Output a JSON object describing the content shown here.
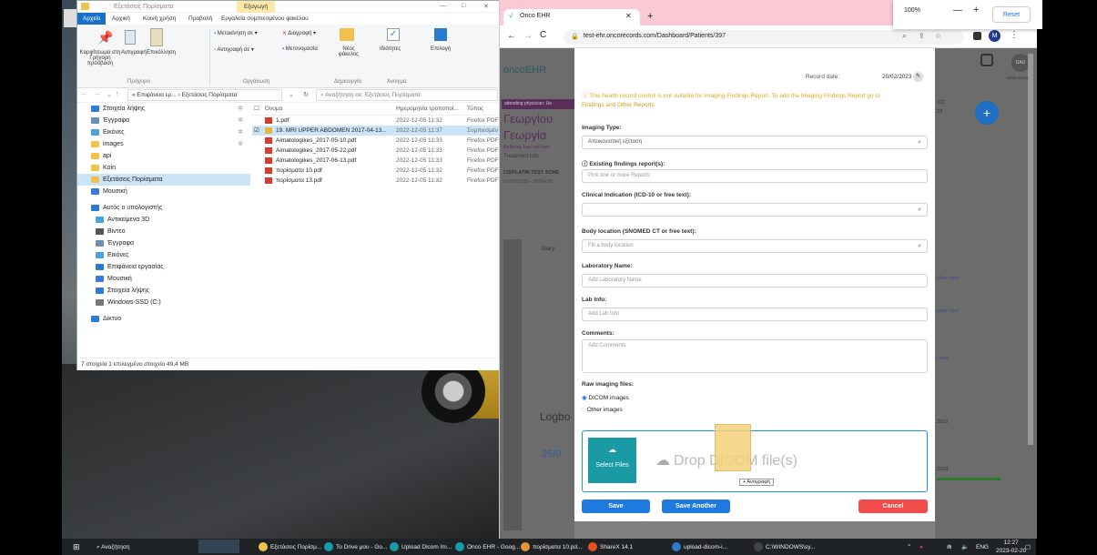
{
  "explorer": {
    "title": "Εξετάσεις Πορίσματα",
    "context_tab": "Εξαγωγή",
    "window_controls": [
      "—",
      "□",
      "✕"
    ],
    "menu": [
      "Αρχείο",
      "Αρχική",
      "Κοινή χρήση",
      "Προβολή",
      "Εργαλεία συμπιεσμένου φακέλου"
    ],
    "ribbon": {
      "pin": "Καρφίτσωμα στη Γρήγορη πρόσβαση",
      "copy": "Αντιγραφή",
      "paste": "Επικόλληση",
      "clipboard_group": "Πρόχειρο",
      "move_to": "Μετακίνηση σε",
      "delete": "Διαγραφή",
      "copy_to": "Αντιγραφή σε",
      "rename": "Μετονομασία",
      "organize_group": "Οργάνωση",
      "new_folder": "Νέος φάκελος",
      "create_group": "Δημιουργία",
      "properties": "Ιδιότητες",
      "open_group": "Άνοιγμα",
      "select": "Επιλογή"
    },
    "address": "« Επιφάνεια ερ... › Εξετάσεις Πορίσματα",
    "search_placeholder": "Αναζήτηση σε: Εξετάσεις Πορίσματα",
    "nav_items": [
      {
        "label": "Στοιχεία λήψης",
        "color": "#2e7bd6",
        "pin": "✲"
      },
      {
        "label": "Έγγραφα",
        "color": "#6a8fb3",
        "pin": "✲"
      },
      {
        "label": "Εικόνες",
        "color": "#4ea0d8",
        "pin": "✲"
      },
      {
        "label": "images",
        "color": "#f0c24b",
        "pin": "✲"
      },
      {
        "label": "api",
        "color": "#f0c24b",
        "pin": ""
      },
      {
        "label": "Koin",
        "color": "#f0c24b",
        "pin": ""
      },
      {
        "label": "Εξετάσεις Πορίσματα",
        "color": "#f0c24b",
        "pin": ""
      },
      {
        "label": "Μουσική",
        "color": "#3b7bd8",
        "pin": ""
      },
      {
        "label": "Αυτός ο υπολογιστής",
        "color": "#2a7ad0",
        "pin": ""
      },
      {
        "label": "Αντικείμενα 3D",
        "color": "#43a5e0",
        "pin": ""
      },
      {
        "label": "Βίντεο",
        "color": "#555",
        "pin": ""
      },
      {
        "label": "Έγγραφα",
        "color": "#6a8fb3",
        "pin": ""
      },
      {
        "label": "Εικόνες",
        "color": "#4ea0d8",
        "pin": ""
      },
      {
        "label": "Επιφάνεια εργασίας",
        "color": "#2a7ad0",
        "pin": ""
      },
      {
        "label": "Μουσική",
        "color": "#3b7bd8",
        "pin": ""
      },
      {
        "label": "Στοιχεία λήψης",
        "color": "#2e7bd6",
        "pin": ""
      },
      {
        "label": "Windows-SSD (C:)",
        "color": "#777",
        "pin": ""
      },
      {
        "label": "Δίκτυο",
        "color": "#2a7ad0",
        "pin": ""
      }
    ],
    "columns": [
      "Όνομα",
      "Ημερομηνία τροποποί...",
      "Τύπος"
    ],
    "files": [
      {
        "name": "1.pdf",
        "date": "2022-12-05 11:32",
        "type": "Firefox PDF",
        "icon": "#d83b2f",
        "selected": false
      },
      {
        "name": "19. MRI UPPER ABDOMEN 2017-04-13...",
        "date": "2022-12-05 11:37",
        "type": "Συμπιεσμέν",
        "icon": "#e8b63a",
        "selected": true
      },
      {
        "name": "Aimatologikes_2017-05-10.pdf",
        "date": "2022-12-05 11:33",
        "type": "Firefox PDF",
        "icon": "#d83b2f",
        "selected": false
      },
      {
        "name": "Aimatologikes_2017-05-22.pdf",
        "date": "2022-12-05 11:33",
        "type": "Firefox PDF",
        "icon": "#d83b2f",
        "selected": false
      },
      {
        "name": "Aimatologikes_2017-06-13.pdf",
        "date": "2022-12-05 11:33",
        "type": "Firefox PDF",
        "icon": "#d83b2f",
        "selected": false
      },
      {
        "name": "πορίσματα 10.pdf",
        "date": "2022-12-05 11:32",
        "type": "Firefox PDF",
        "icon": "#d83b2f",
        "selected": false
      },
      {
        "name": "πορίσματα 13.pdf",
        "date": "2022-12-05 11:32",
        "type": "Firefox PDF",
        "icon": "#d83b2f",
        "selected": false
      }
    ],
    "status": "7 στοιχεία    1 επιλεγμένο στοιχείο 49,4 MB"
  },
  "browser": {
    "tab_title": "Onco EHR",
    "url": "test-ehr.oncorecords.com/Dashboard/Patients/397",
    "zoom": "100%",
    "zoom_minus": "—",
    "zoom_plus": "+",
    "reset": "Reset",
    "avatar": "M"
  },
  "ehr": {
    "logo": "oncoEHR",
    "physician_badge": "attending physician: Ue",
    "patient_first": "Γεωργίου",
    "patient_last": "Γεωργία",
    "birthday_note": "Birthday has not bee",
    "treatment_info": "Treatment Info",
    "treatment_name": "CISPLATIN TEST SCHE",
    "treatment_dates": "02/02/2023 - 26/04/20",
    "diary": "Diary",
    "logbook": "Logbo",
    "log_date": "26/0",
    "user": "DAU",
    "user_name": "Admin Elina",
    "right_year": "022",
    "right_year2": "23",
    "right_links": [
      "efine now",
      "efine now",
      "l now"
    ],
    "right_date": "2023",
    "right_date2": "2023"
  },
  "modal": {
    "record_date_label": "Record date:",
    "record_date": "20/02/2023",
    "warning": "This health record control is not suitable for Imaging Findings Report. To add the Imaging Findings Report go to",
    "warning_link": "Findings and Other Reports",
    "imaging_type_label": "Imaging Type:",
    "imaging_type_value": "Απεικονιστική εξέταση",
    "existing_label": "Existing findings report(s):",
    "existing_placeholder": "Pick one or more Reports",
    "clinical_label": "Clinical Indication (ICD-10 or free text):",
    "body_label": "Body location (SNOMED CT or free text):",
    "body_placeholder": "Fill a body location",
    "lab_name_label": "Laboratory Name:",
    "lab_name_placeholder": "Add Laboratory Name",
    "lab_info_label": "Lab Info:",
    "lab_info_placeholder": "Add Lab Info",
    "comments_label": "Comments:",
    "comments_placeholder": "Add Comments",
    "raw_label": "Raw imaging files:",
    "radio_dicom": "DICOM images",
    "radio_other": "Other images",
    "select_files": "Select Files",
    "drop_text": "Drop DICOM file(s)",
    "drag_tooltip": "+ Αντιγραφή",
    "save": "Save",
    "save_another": "Save Another",
    "cancel": "Cancel"
  },
  "taskbar": {
    "search": "Αναζήτηση",
    "items": [
      "Εξετάσεις Πορίσμ...",
      "To Drive μου - Go...",
      "Upload Dicom Im...",
      "Onco EHR - Goog...",
      "πορίσματα 10.pd...",
      "ShareX 14.1",
      "upload-dicom-i...",
      "C:\\WINDOWS\\sy..."
    ],
    "lang": "ENG",
    "time": "12:27",
    "date": "2023-02-20"
  },
  "colors": {
    "accent": "#1a73e8",
    "ehr_teal": "#1a9aa5",
    "save_blue": "#1f7ae0",
    "cancel_red": "#f24b4b",
    "tab_pink": "#fbc9d3",
    "warning": "#e0a81b"
  }
}
